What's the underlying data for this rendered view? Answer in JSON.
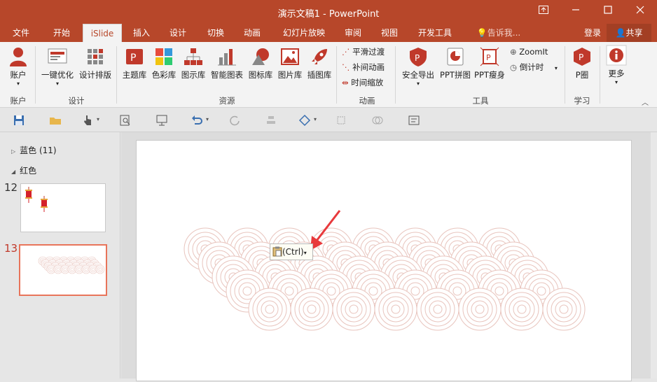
{
  "window": {
    "title": "演示文稿1 - PowerPoint",
    "controls": [
      "restore-ribbon",
      "minimize",
      "maximize",
      "close"
    ]
  },
  "tabs": [
    {
      "label": "文件"
    },
    {
      "label": "开始"
    },
    {
      "label": "iSlide",
      "active": true
    },
    {
      "label": "插入"
    },
    {
      "label": "设计"
    },
    {
      "label": "切换"
    },
    {
      "label": "动画"
    },
    {
      "label": "幻灯片放映"
    },
    {
      "label": "审阅"
    },
    {
      "label": "视图"
    },
    {
      "label": "开发工具"
    }
  ],
  "tellme": "告诉我...",
  "signin": "登录",
  "share": "共享",
  "ribbon": {
    "account": {
      "btn": "账户",
      "group": "账户"
    },
    "design": {
      "btn1": "一键优化",
      "btn2": "设计排版",
      "group": "设计"
    },
    "resources": {
      "items": [
        "主题库",
        "色彩库",
        "图示库",
        "智能图表",
        "图标库",
        "图片库",
        "插图库"
      ],
      "group": "资源"
    },
    "animation": {
      "items": [
        "平滑过渡",
        "补间动画",
        "时间缩放"
      ],
      "group": "动画"
    },
    "tools": {
      "export": "安全导出",
      "puzzle": "PPT拼图",
      "slim": "PPT瘦身",
      "zoomit": "ZoomIt",
      "countdown": "倒计时",
      "group": "工具"
    },
    "learn": {
      "btn": "P圈",
      "group": "学习"
    },
    "more": "更多"
  },
  "sections": [
    {
      "label": "蓝色 (11)",
      "collapsed": true
    },
    {
      "label": "红色",
      "collapsed": false
    }
  ],
  "thumbs": [
    {
      "number": "12",
      "selected": false
    },
    {
      "number": "13",
      "selected": true
    }
  ],
  "paste_options": {
    "label": "(Ctrl)"
  },
  "colors": {
    "accent": "#b7472a",
    "ribbon_bg": "#f3f3f3",
    "circle_stroke": "#e8c4bd",
    "arrow": "#e8393c",
    "selected_thumb": "#e8745a"
  }
}
